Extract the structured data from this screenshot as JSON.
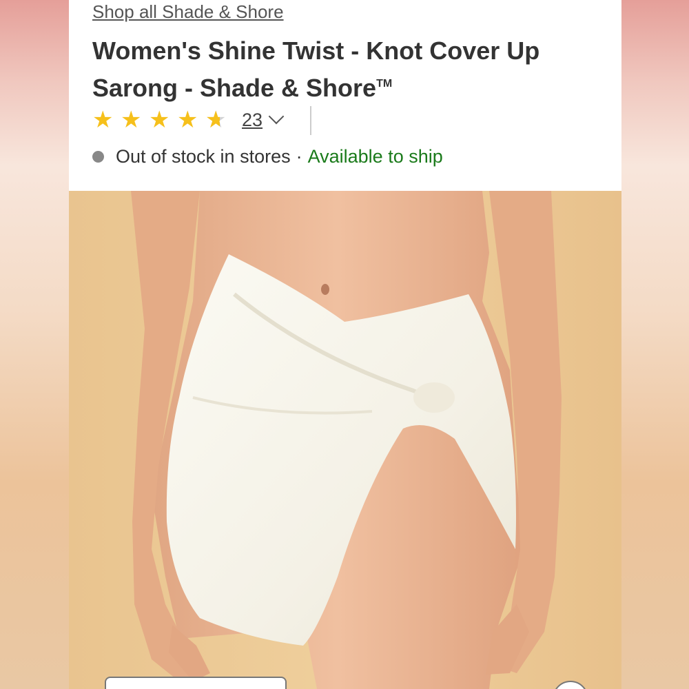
{
  "breadcrumb": {
    "label": "Shop all Shade & Shore"
  },
  "product": {
    "title": "Women's Shine Twist - Knot Cover Up Sarong - Shade & Shore",
    "trademark": "TM",
    "rating": {
      "value": 4.5,
      "max": 5,
      "count": "23"
    },
    "availability": {
      "store_status": "Out of stock in stores",
      "separator": "·",
      "ship_status": "Available to ship"
    }
  },
  "icons": {
    "rating_star": "star-icon",
    "expand": "chevron-down-icon",
    "status": "status-dot-icon"
  },
  "colors": {
    "star": "#f6c01b",
    "available": "#1a7a1a",
    "status_dot": "#888888",
    "title": "#333333"
  }
}
